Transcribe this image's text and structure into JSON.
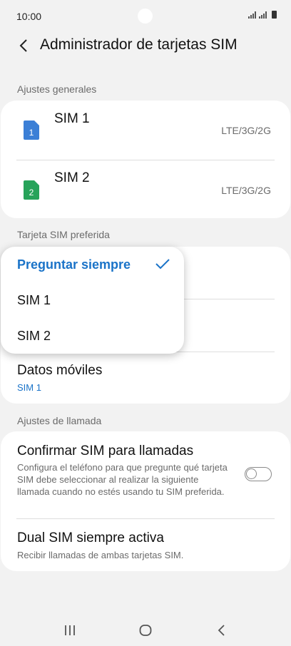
{
  "status_bar": {
    "time": "10:00"
  },
  "header": {
    "title": "Administrador de tarjetas SIM"
  },
  "general": {
    "label": "Ajustes generales",
    "sims": [
      {
        "name": "SIM 1",
        "number": "1",
        "tech": "LTE/3G/2G",
        "color": "#3b7fd6"
      },
      {
        "name": "SIM 2",
        "number": "2",
        "tech": "LTE/3G/2G",
        "color": "#27a35a"
      }
    ]
  },
  "preferred": {
    "label": "Tarjeta SIM preferida",
    "mobile_data": {
      "title": "Datos móviles",
      "value": "SIM 1"
    }
  },
  "popup": {
    "options": [
      {
        "label": "Preguntar siempre",
        "selected": true
      },
      {
        "label": "SIM 1",
        "selected": false
      },
      {
        "label": "SIM 2",
        "selected": false
      }
    ]
  },
  "calls": {
    "label": "Ajustes de llamada",
    "confirm": {
      "title": "Confirmar SIM para llamadas",
      "desc": "Configura el teléfono para que pregunte qué tarjeta SIM debe seleccionar al realizar la siguiente llamada cuando no estés usando tu SIM preferida.",
      "enabled": false
    },
    "dual": {
      "title": "Dual SIM siempre activa",
      "desc": "Recibir llamadas de ambas tarjetas SIM."
    }
  },
  "colors": {
    "accent": "#1a73c8",
    "background": "#f2f2f2"
  }
}
